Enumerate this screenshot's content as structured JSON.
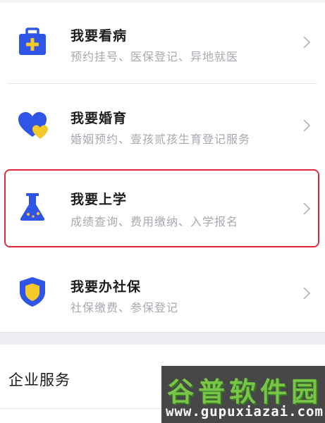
{
  "services": [
    {
      "title": "我要看病",
      "subtitle": "预约挂号、医保登记、异地就医",
      "icon": "medical-kit-icon"
    },
    {
      "title": "我要婚育",
      "subtitle": "婚姻预约、壹孩贰孩生育登记服务",
      "icon": "hearts-icon"
    },
    {
      "title": "我要上学",
      "subtitle": "成绩查询、费用缴纳、入学报名",
      "icon": "flask-icon",
      "highlighted": true
    },
    {
      "title": "我要办社保",
      "subtitle": "社保缴费、参保登记",
      "icon": "shield-icon"
    }
  ],
  "enterprise": {
    "label": "企业服务"
  },
  "watermark": {
    "title": "谷普软件园",
    "url": "www.gupuxiazai.com"
  },
  "colors": {
    "icon_blue": "#2f55e6",
    "icon_yellow": "#f6c92b",
    "highlight_red": "#e0293c"
  }
}
